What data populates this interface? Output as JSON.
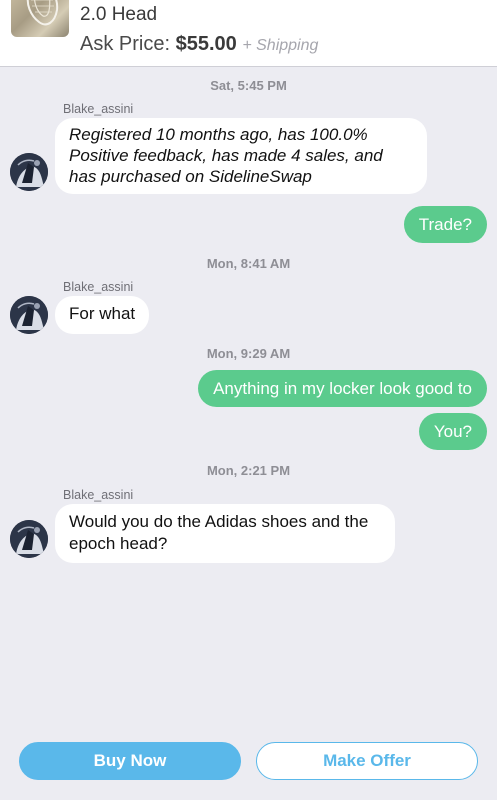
{
  "header": {
    "title": "2.0 Head",
    "ask_price_label": "Ask Price:",
    "ask_price": "$55.00",
    "shipping": "+ Shipping"
  },
  "messages": [
    {
      "type": "timestamp",
      "text": "Sat, 5:45 PM"
    },
    {
      "type": "incoming",
      "sender": "Blake_assini",
      "text": "Registered 10 months ago, has 100.0% Positive feedback, has made 4 sales, and has purchased on SidelineSwap"
    },
    {
      "type": "outgoing",
      "text": "Trade?"
    },
    {
      "type": "timestamp",
      "text": "Mon, 8:41 AM"
    },
    {
      "type": "incoming",
      "sender": "Blake_assini",
      "text": "For what"
    },
    {
      "type": "timestamp",
      "text": "Mon, 9:29 AM"
    },
    {
      "type": "outgoing",
      "text": "Anything in my locker look good to"
    },
    {
      "type": "outgoing",
      "text": "You?"
    },
    {
      "type": "timestamp",
      "text": "Mon, 2:21 PM"
    },
    {
      "type": "incoming",
      "sender": "Blake_assini",
      "text": "Would you do the Adidas shoes and the epoch head?"
    }
  ],
  "buttons": {
    "buy_now": "Buy Now",
    "make_offer": "Make Offer"
  },
  "colors": {
    "outgoing_bubble": "#5bcb8d",
    "incoming_bubble": "#ffffff",
    "accent_blue": "#5ab8ea",
    "chat_background": "#ececf2"
  },
  "icons": {
    "listing_thumbnail": "lacrosse-head-thumbnail",
    "avatar": "user-avatar"
  }
}
